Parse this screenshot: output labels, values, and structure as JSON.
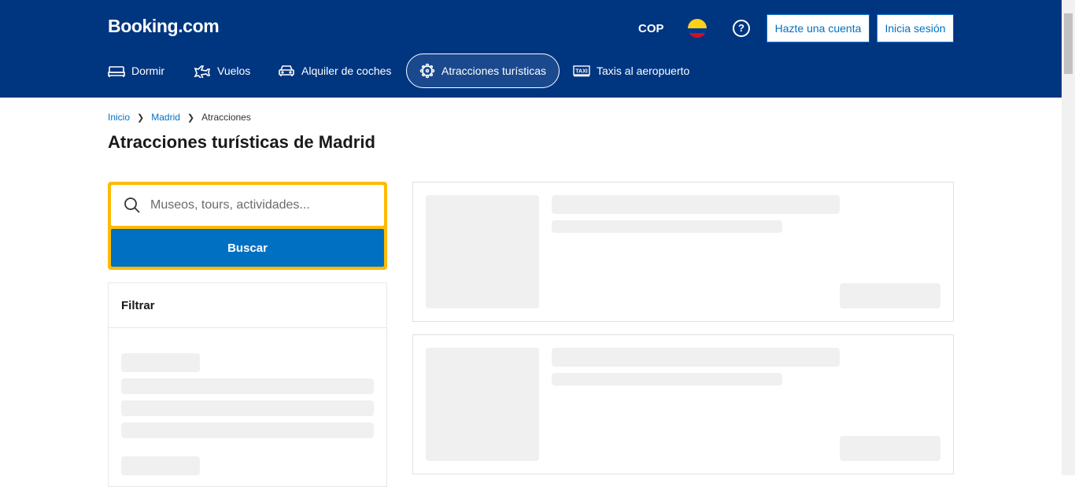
{
  "header": {
    "logo": "Booking.com",
    "currency": "COP",
    "help_icon": "?",
    "register_label": "Hazte una cuenta",
    "signin_label": "Inicia sesión"
  },
  "nav": {
    "items": [
      {
        "label": "Dormir",
        "icon": "bed-icon"
      },
      {
        "label": "Vuelos",
        "icon": "plane-icon"
      },
      {
        "label": "Alquiler de coches",
        "icon": "car-icon"
      },
      {
        "label": "Atracciones turísticas",
        "icon": "attractions-icon",
        "active": true
      },
      {
        "label": "Taxis al aeropuerto",
        "icon": "taxi-icon"
      }
    ]
  },
  "breadcrumb": {
    "items": [
      "Inicio",
      "Madrid",
      "Atracciones"
    ]
  },
  "page_title": "Atracciones turísticas de Madrid",
  "search": {
    "placeholder": "Museos, tours, actividades...",
    "button_label": "Buscar"
  },
  "filter": {
    "title": "Filtrar"
  },
  "colors": {
    "header_bg": "#003580",
    "accent": "#0071c2",
    "search_border": "#febb02",
    "skeleton": "#f0f0f0"
  }
}
